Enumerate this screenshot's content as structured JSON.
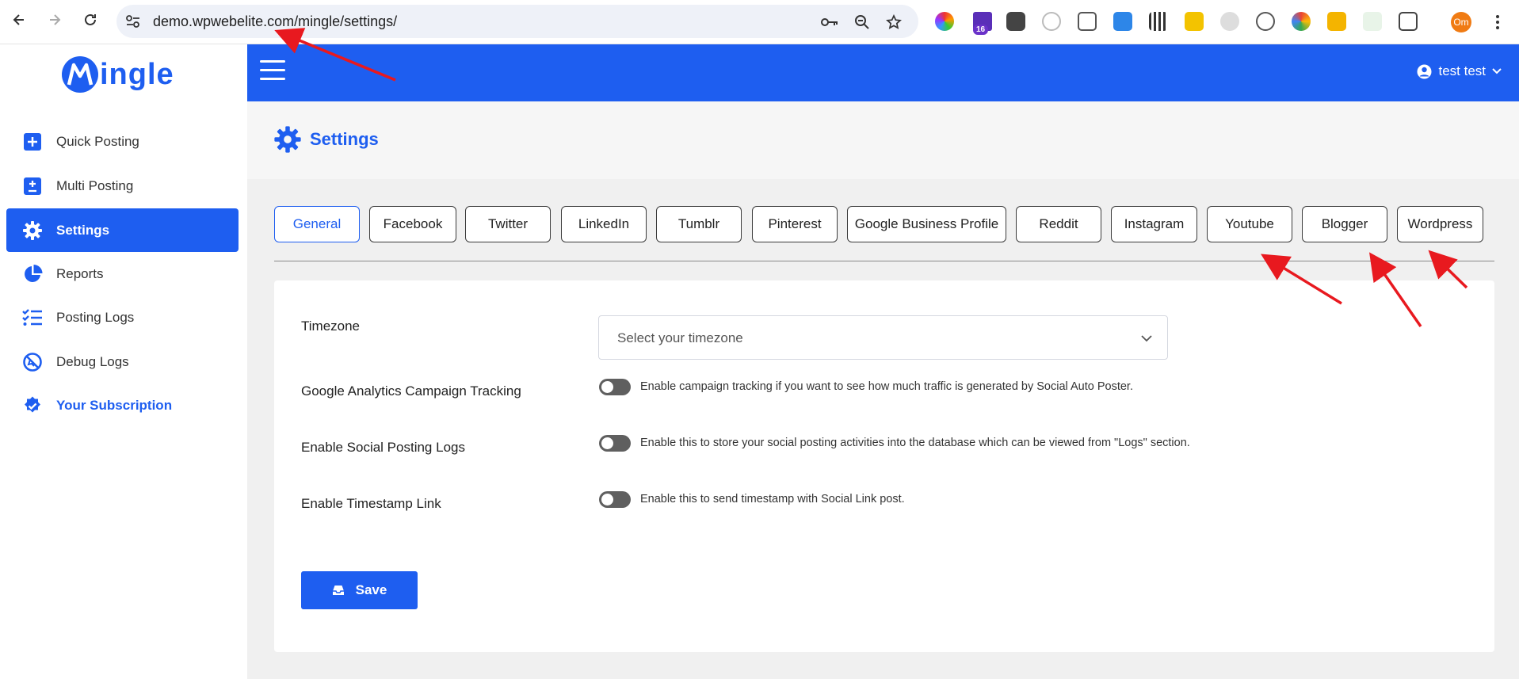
{
  "browser": {
    "url": "demo.wpwebelite.com/mingle/settings/",
    "extension_badge": "16",
    "profile_initials": "Om"
  },
  "logo": {
    "letter": "M",
    "text": "ingle"
  },
  "sidebar": {
    "items": [
      {
        "label": "Quick Posting",
        "icon": "plus-square-icon"
      },
      {
        "label": "Multi Posting",
        "icon": "plus-minus-square-icon"
      },
      {
        "label": "Settings",
        "icon": "gear-icon",
        "active": true
      },
      {
        "label": "Reports",
        "icon": "pie-chart-icon"
      },
      {
        "label": "Posting Logs",
        "icon": "checklist-icon"
      },
      {
        "label": "Debug Logs",
        "icon": "debug-icon"
      },
      {
        "label": "Your Subscription",
        "icon": "verified-badge-icon"
      }
    ]
  },
  "topbar": {
    "user_name": "test test"
  },
  "page": {
    "title": "Settings"
  },
  "tabs": [
    {
      "label": "General",
      "active": true
    },
    {
      "label": "Facebook"
    },
    {
      "label": "Twitter"
    },
    {
      "label": "LinkedIn"
    },
    {
      "label": "Tumblr"
    },
    {
      "label": "Pinterest"
    },
    {
      "label": "Google Business Profile"
    },
    {
      "label": "Reddit"
    },
    {
      "label": "Instagram"
    },
    {
      "label": "Youtube"
    },
    {
      "label": "Blogger"
    },
    {
      "label": "Wordpress"
    }
  ],
  "form": {
    "timezone": {
      "label": "Timezone",
      "placeholder": "Select your timezone"
    },
    "ga_tracking": {
      "label": "Google Analytics Campaign Tracking",
      "help": "Enable campaign tracking if you want to see how much traffic is generated by Social Auto Poster.",
      "enabled": false
    },
    "posting_logs": {
      "label": "Enable Social Posting Logs",
      "help": "Enable this to store your social posting activities into the database which can be viewed from \"Logs\" section.",
      "enabled": false
    },
    "timestamp_link": {
      "label": "Enable Timestamp Link",
      "help": "Enable this to send timestamp with Social Link post.",
      "enabled": false
    },
    "save_label": "Save"
  },
  "colors": {
    "brand": "#1e5ef0",
    "annotation": "#e8191f"
  }
}
